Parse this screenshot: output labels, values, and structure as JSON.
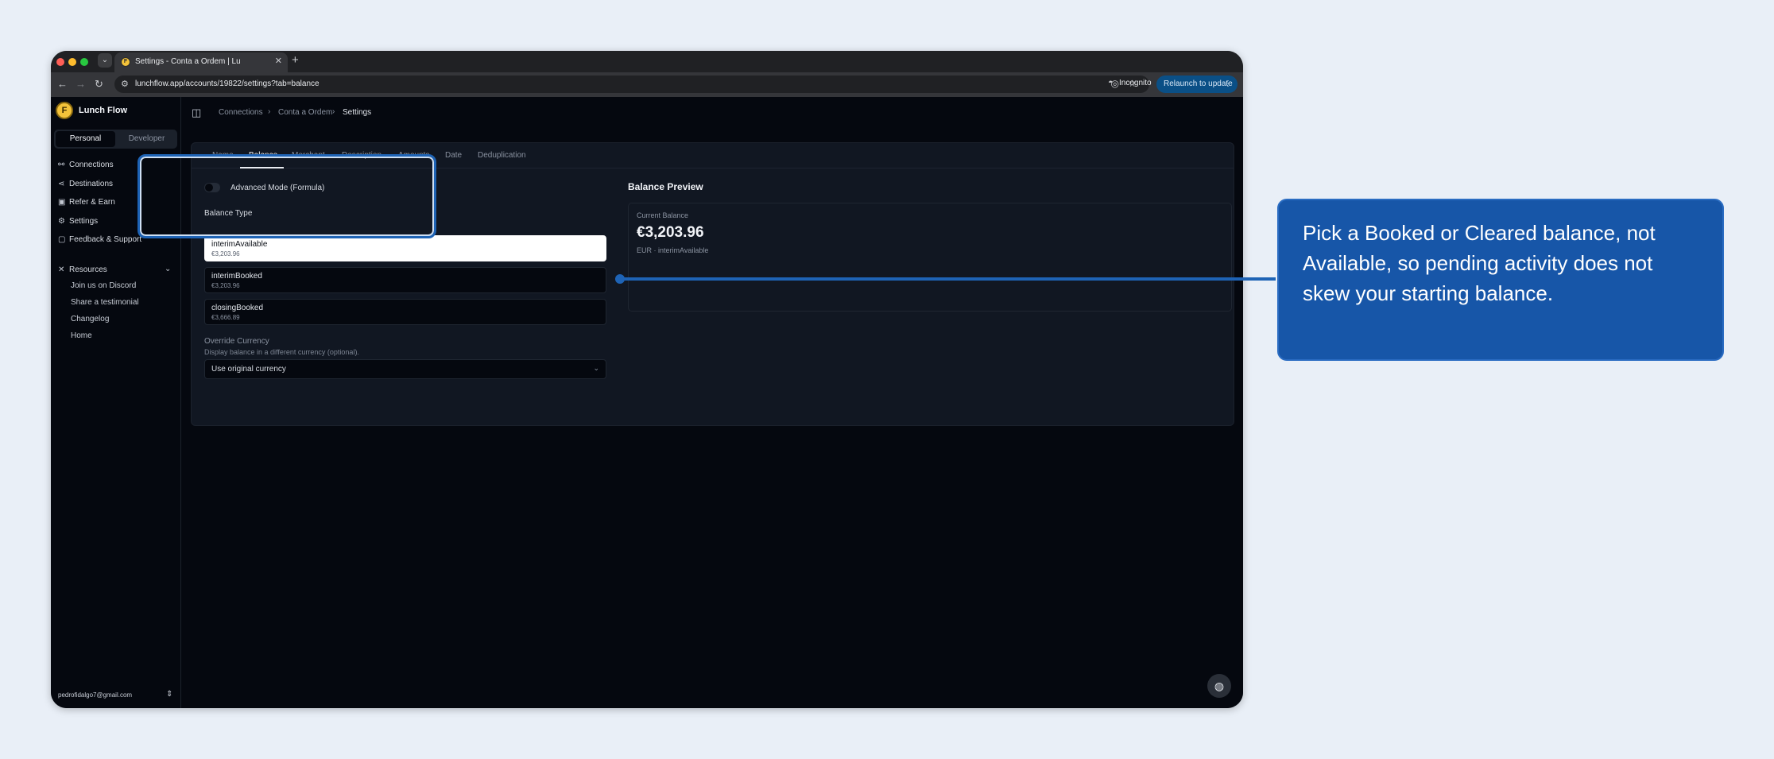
{
  "browser": {
    "tab_title": "Settings - Conta a Ordem | Lu",
    "url": "lunchflow.app/accounts/19822/settings?tab=balance",
    "incognito_label": "Incognito",
    "relaunch_label": "Relaunch to update"
  },
  "sidebar": {
    "brand": "Lunch Flow",
    "segment": {
      "active": "Personal",
      "inactive": "Developer"
    },
    "items": [
      {
        "label": "Connections"
      },
      {
        "label": "Destinations"
      },
      {
        "label": "Refer & Earn"
      },
      {
        "label": "Settings"
      },
      {
        "label": "Feedback & Support"
      }
    ],
    "resources_label": "Resources",
    "resources": [
      "Join us on Discord",
      "Share a testimonial",
      "Changelog",
      "Home"
    ],
    "email": "pedrofidalgo7@gmail.com"
  },
  "breadcrumb": [
    "Connections",
    "Conta a Ordem",
    "Settings"
  ],
  "tabs": [
    "Name",
    "Balance",
    "Merchant",
    "Description",
    "Amounts",
    "Date",
    "Deduplication"
  ],
  "settings": {
    "advanced_mode_label": "Advanced Mode (Formula)",
    "balance_type_label": "Balance Type",
    "options": [
      {
        "name": "interimAvailable",
        "value": "€3,203.96",
        "selected": true
      },
      {
        "name": "interimBooked",
        "value": "€3,203.96",
        "selected": false
      },
      {
        "name": "closingBooked",
        "value": "€3,666.89",
        "selected": false
      }
    ],
    "override_label": "Override Currency",
    "override_desc": "Display balance in a different currency (optional).",
    "override_value": "Use original currency"
  },
  "preview": {
    "title": "Balance Preview",
    "label": "Current Balance",
    "amount": "€3,203.96",
    "meta": "EUR · interimAvailable"
  },
  "callout": {
    "text": "Pick a Booked or Cleared balance, not Available, so pending activity does not skew your starting balance."
  },
  "colors": {
    "accent": "#1e63b5",
    "callout_bg": "#1756a8",
    "app_bg": "#05080f"
  }
}
